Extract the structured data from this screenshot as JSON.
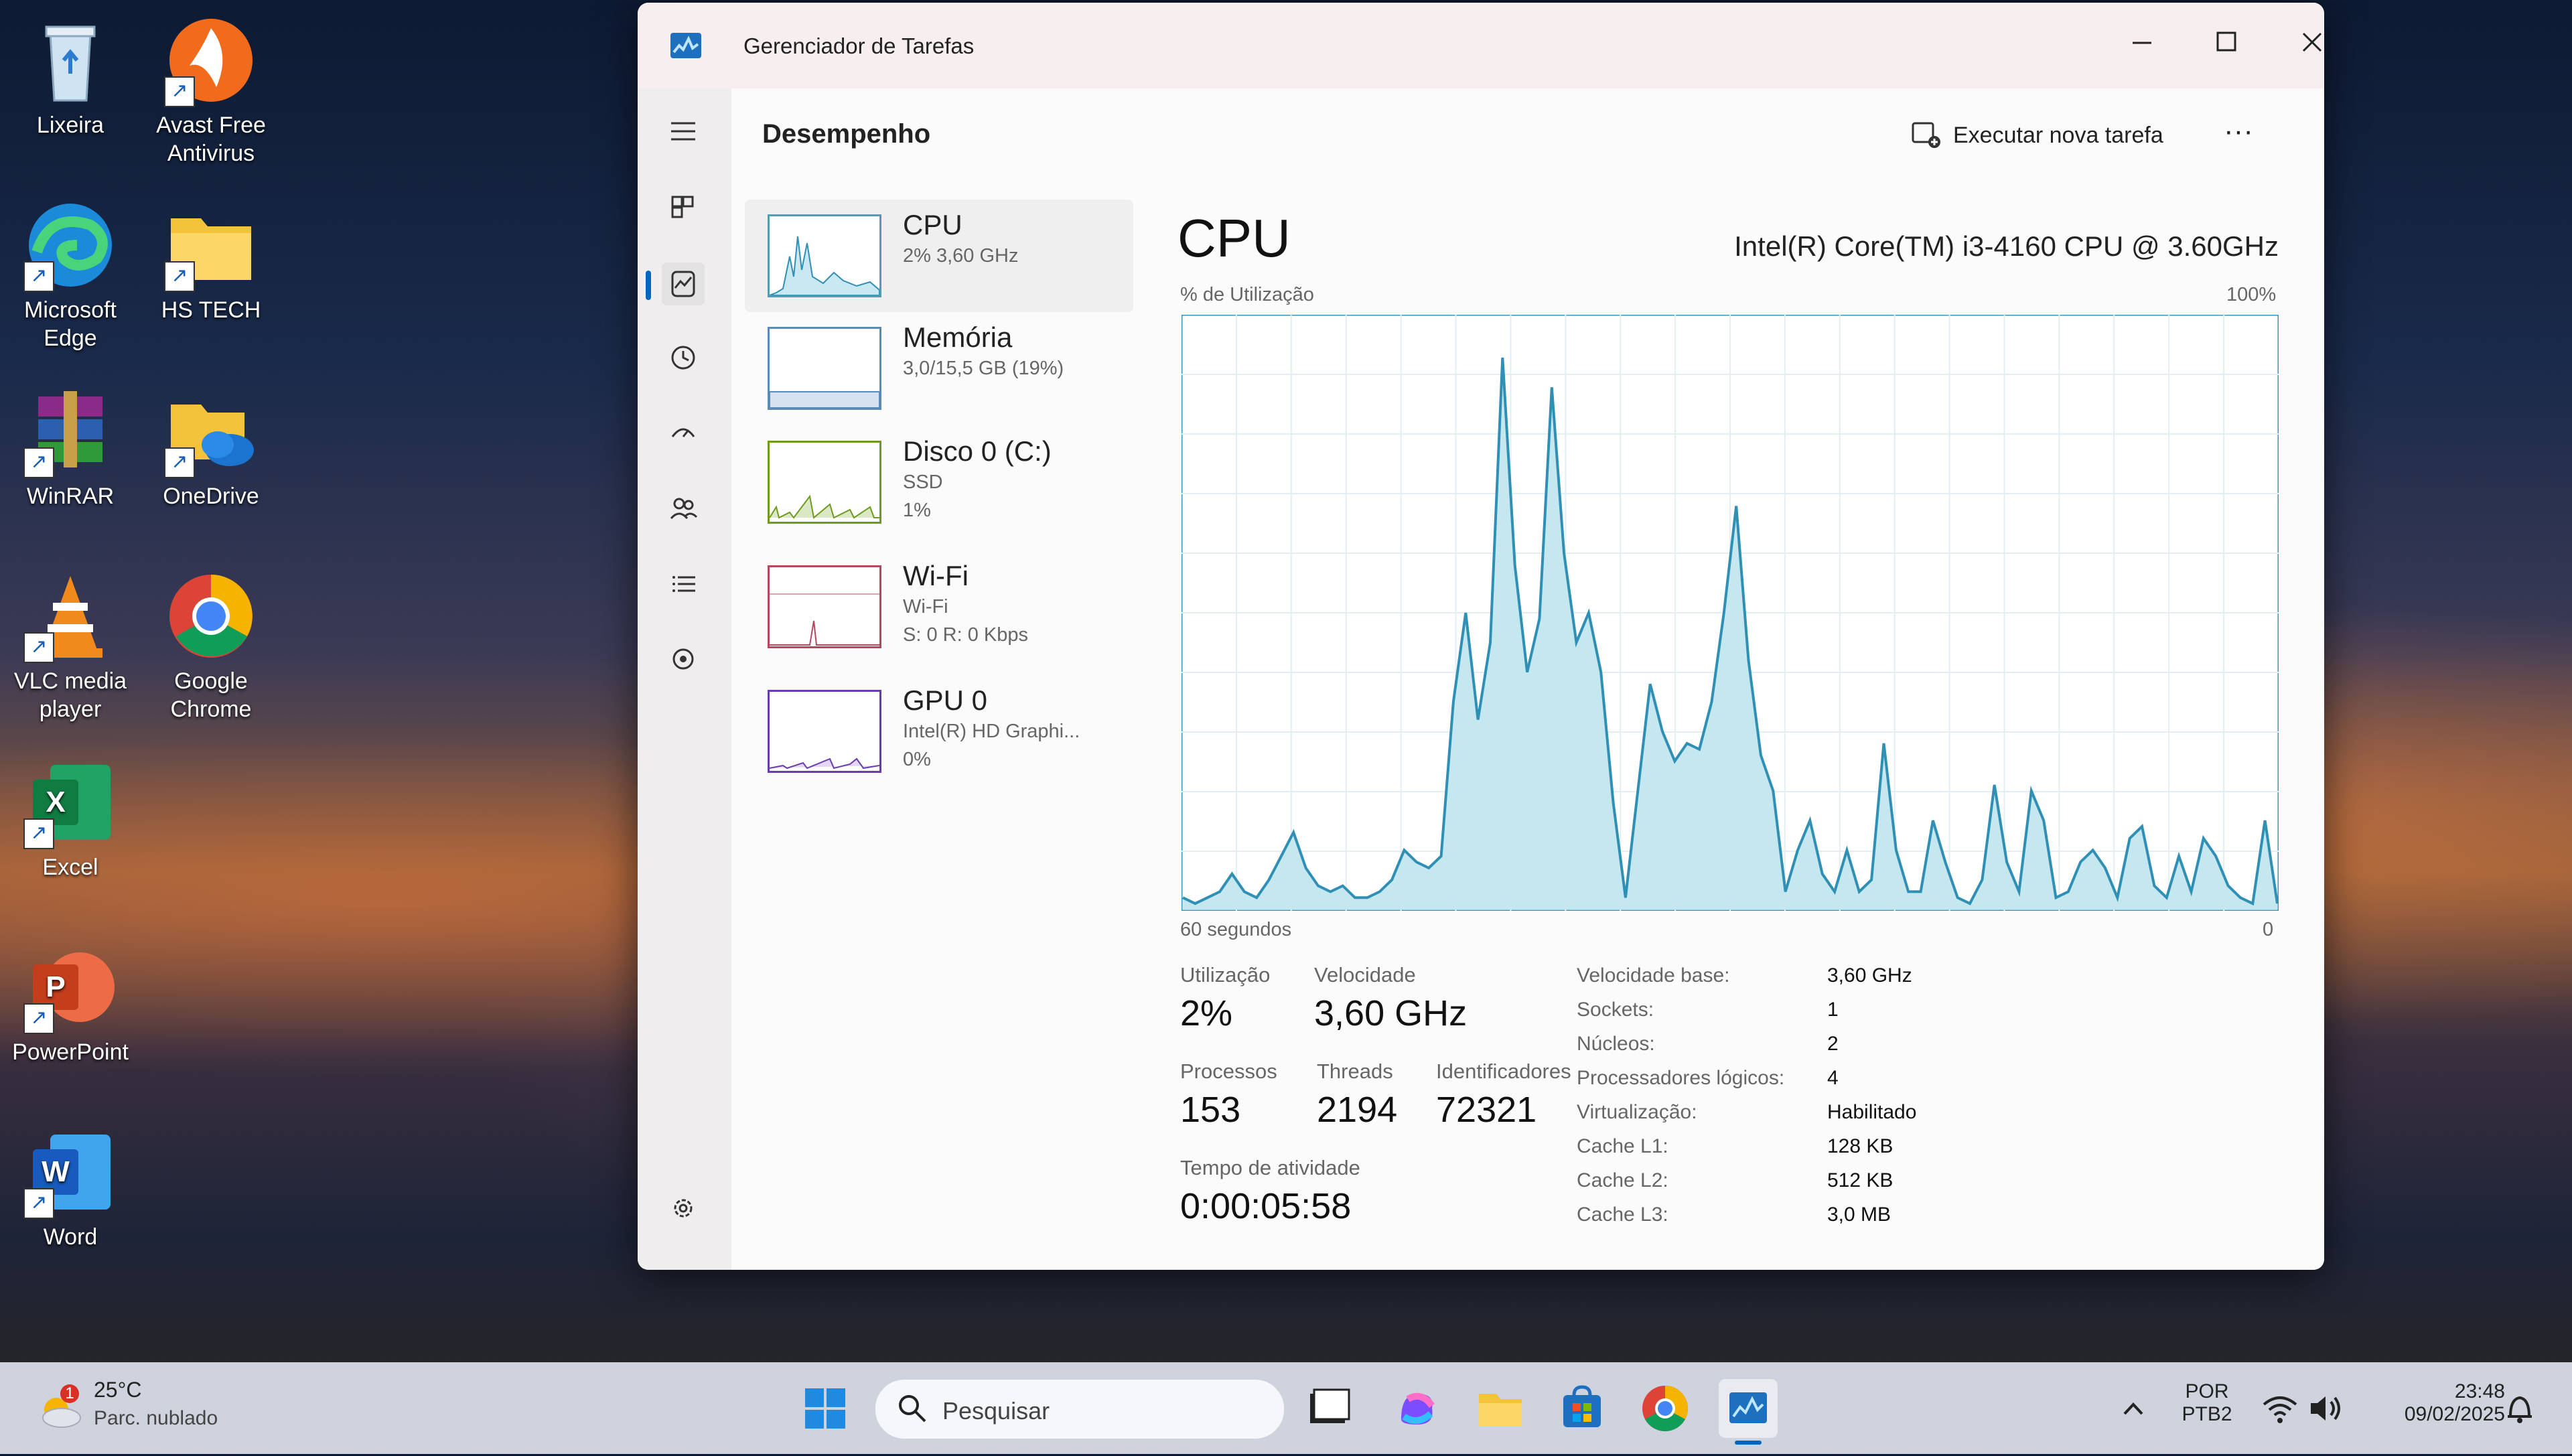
{
  "desktop": {
    "icons": [
      {
        "label": "Lixeira",
        "name": "recycle-bin"
      },
      {
        "label": "Avast Free Antivirus",
        "name": "avast"
      },
      {
        "label": "Microsoft Edge",
        "name": "edge"
      },
      {
        "label": "HS TECH",
        "name": "hs-tech-folder"
      },
      {
        "label": "WinRAR",
        "name": "winrar"
      },
      {
        "label": "OneDrive",
        "name": "onedrive"
      },
      {
        "label": "VLC media player",
        "name": "vlc"
      },
      {
        "label": "Google Chrome",
        "name": "chrome"
      },
      {
        "label": "Excel",
        "name": "excel"
      },
      {
        "label": "PowerPoint",
        "name": "powerpoint"
      },
      {
        "label": "Word",
        "name": "word"
      }
    ]
  },
  "window": {
    "title": "Gerenciador de Tarefas",
    "header_title": "Desempenho",
    "run_task_label": "Executar nova tarefa",
    "more_label": "···"
  },
  "perf_list": [
    {
      "name": "CPU",
      "sub1": "2% 3,60 GHz",
      "sub2": "",
      "color": "#2f8fb4"
    },
    {
      "name": "Memória",
      "sub1": "3,0/15,5 GB (19%)",
      "sub2": "",
      "color": "#5a8ab8"
    },
    {
      "name": "Disco 0 (C:)",
      "sub1": "SSD",
      "sub2": "1%",
      "color": "#6e9a1e"
    },
    {
      "name": "Wi-Fi",
      "sub1": "Wi-Fi",
      "sub2": "S: 0 R: 0 Kbps",
      "color": "#b5475e"
    },
    {
      "name": "GPU 0",
      "sub1": "Intel(R) HD Graphi...",
      "sub2": "0%",
      "color": "#6a3ab0"
    }
  ],
  "detail": {
    "title": "CPU",
    "model": "Intel(R) Core(TM) i3-4160 CPU @ 3.60GHz",
    "graph_label": "% de Utilização",
    "graph_max": "100%",
    "graph_time": "60 segundos",
    "graph_min": "0"
  },
  "chart_data": {
    "type": "area",
    "ylim": [
      0,
      100
    ],
    "series": [
      {
        "values": [
          2,
          1,
          2,
          3,
          6,
          3,
          2,
          5,
          9,
          13,
          7,
          4,
          3,
          4,
          2,
          2,
          3,
          5,
          10,
          8,
          7,
          9,
          35,
          50,
          32,
          45,
          93,
          58,
          40,
          49,
          88,
          60,
          45,
          50,
          40,
          18,
          2,
          20,
          38,
          30,
          25,
          28,
          27,
          35,
          50,
          68,
          42,
          26,
          20,
          3,
          10,
          15,
          6,
          3,
          10,
          3,
          5,
          28,
          10,
          3,
          3,
          15,
          8,
          2,
          1,
          5,
          21,
          8,
          3,
          20,
          15,
          2,
          3,
          8,
          10,
          7,
          2,
          12,
          14,
          4,
          2,
          9,
          3,
          12,
          9,
          4,
          2,
          1,
          15,
          1
        ]
      }
    ]
  },
  "stats": {
    "utilization_label": "Utilização",
    "utilization": "2%",
    "speed_label": "Velocidade",
    "speed": "3,60 GHz",
    "processes_label": "Processos",
    "processes": "153",
    "threads_label": "Threads",
    "threads": "2194",
    "handles_label": "Identificadores",
    "handles": "72321",
    "uptime_label": "Tempo de atividade",
    "uptime": "0:00:05:58"
  },
  "properties": [
    {
      "label": "Velocidade base:",
      "value": "3,60 GHz"
    },
    {
      "label": "Sockets:",
      "value": "1"
    },
    {
      "label": "Núcleos:",
      "value": "2"
    },
    {
      "label": "Processadores lógicos:",
      "value": "4"
    },
    {
      "label": "Virtualização:",
      "value": "Habilitado"
    },
    {
      "label": "Cache L1:",
      "value": "128 KB"
    },
    {
      "label": "Cache L2:",
      "value": "512 KB"
    },
    {
      "label": "Cache L3:",
      "value": "3,0 MB"
    }
  ],
  "taskbar": {
    "weather_temp": "25°C",
    "weather_desc": "Parc. nublado",
    "weather_badge": "1",
    "search_placeholder": "Pesquisar",
    "lang_line1": "POR",
    "lang_line2": "PTB2",
    "time": "23:48",
    "date": "09/02/2025"
  }
}
